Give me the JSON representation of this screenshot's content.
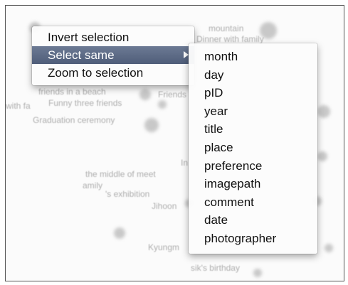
{
  "background": {
    "captions": [
      "Dinner with family",
      "mountain",
      "friends in a beach",
      "Friends",
      "Funny three friends",
      "with fa",
      "Graduation ceremony",
      "the middle of meet",
      "In",
      "amily",
      "'s exhibition",
      "Jihoon",
      "Kyungm",
      "sik's birthday"
    ]
  },
  "context_menu": {
    "items": [
      {
        "label": "Invert selection"
      },
      {
        "label": "Select same"
      },
      {
        "label": "Zoom to selection"
      }
    ]
  },
  "submenu": {
    "items": [
      {
        "label": "month"
      },
      {
        "label": "day"
      },
      {
        "label": "pID"
      },
      {
        "label": "year"
      },
      {
        "label": "title"
      },
      {
        "label": "place"
      },
      {
        "label": "preference"
      },
      {
        "label": "imagepath"
      },
      {
        "label": "comment"
      },
      {
        "label": "date"
      },
      {
        "label": "photographer"
      }
    ]
  },
  "colors": {
    "highlight": "#5b6986",
    "bubble": "#bcbcbc",
    "ghost_text": "#a0a0a0"
  }
}
